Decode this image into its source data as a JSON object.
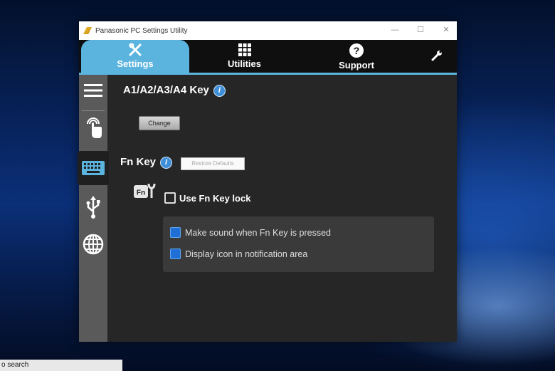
{
  "window": {
    "title": "Panasonic PC Settings Utility",
    "controls": {
      "minimize": "—",
      "maximize": "☐",
      "close": "✕"
    }
  },
  "tabs": [
    {
      "label": "Settings",
      "icon": "tools-icon",
      "active": true
    },
    {
      "label": "Utilities",
      "icon": "grid-icon",
      "active": false
    },
    {
      "label": "Support",
      "icon": "help-icon",
      "active": false
    },
    {
      "label": "",
      "icon": "wrench-icon",
      "active": false
    }
  ],
  "sidebar": {
    "items": [
      {
        "icon": "menu-icon",
        "active": false
      },
      {
        "icon": "touch-icon",
        "active": false
      },
      {
        "icon": "keyboard-icon",
        "active": true
      },
      {
        "icon": "usb-icon",
        "active": false
      },
      {
        "icon": "globe-icon",
        "active": false
      }
    ]
  },
  "a_keys": {
    "title": "A1/A2/A3/A4 Key",
    "info": "i",
    "change_label": "Change"
  },
  "fn_key": {
    "title": "Fn Key",
    "info": "i",
    "restore_label": "Restore Defaults",
    "icon_text": "Fn",
    "use_lock_label": "Use Fn Key lock",
    "use_lock_checked": false,
    "options": [
      {
        "label": "Make sound when Fn Key is pressed",
        "checked": true
      },
      {
        "label": "Display icon in notification area",
        "checked": true
      }
    ]
  },
  "taskbar": {
    "search_text": "o search"
  },
  "colors": {
    "accent": "#5bb4de",
    "checkbox_blue": "#1f6fd6",
    "panel_bg": "#262626",
    "sidebar_bg": "#5a5a5a"
  }
}
